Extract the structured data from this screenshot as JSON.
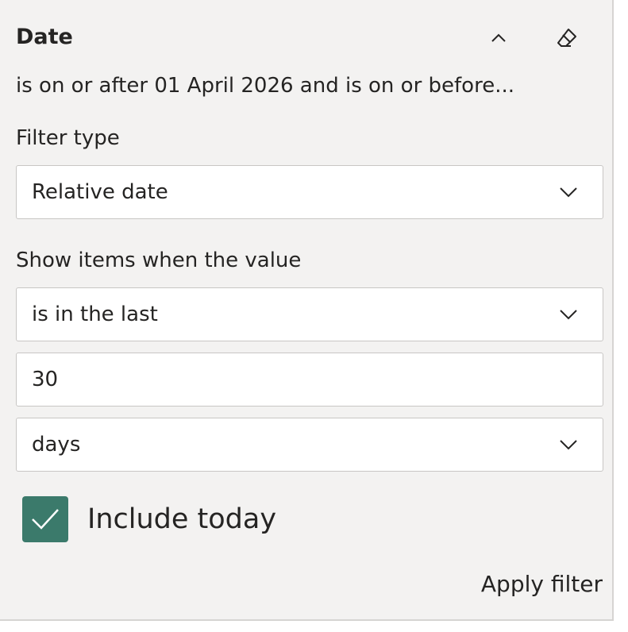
{
  "filter_card": {
    "title": "Date",
    "summary": "is on or after 01 April 2026 and is on or before...",
    "collapse_icon": "chevron-up-icon",
    "clear_icon": "eraser-icon",
    "filter_type_label": "Filter type",
    "filter_type_value": "Relative date",
    "show_items_label": "Show items when the value",
    "operator_value": "is in the last",
    "amount_value": "30",
    "unit_value": "days",
    "include_today_label": "Include today",
    "include_today_checked": true,
    "apply_label": "Apply filter",
    "colors": {
      "pane_background": "#f3f2f1",
      "checkbox_fill": "#3b7a6b",
      "text": "#252423"
    }
  }
}
